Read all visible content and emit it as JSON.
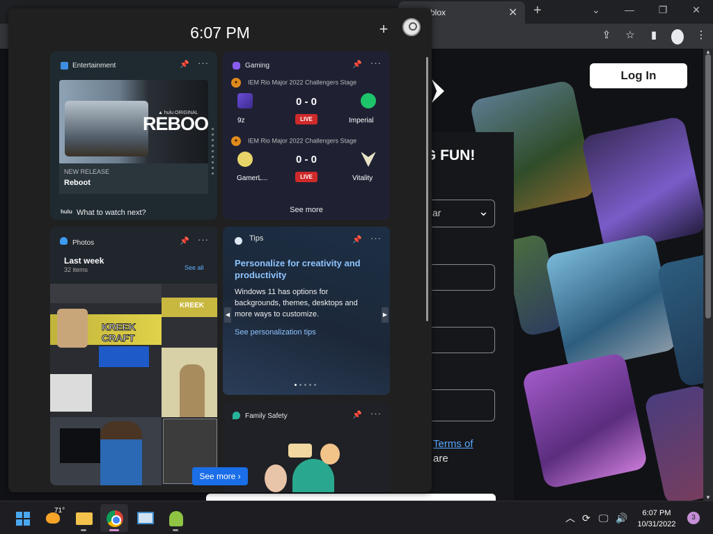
{
  "browser": {
    "tab_title": "blox",
    "tab_close": "✕",
    "new_tab": "+",
    "controls": {
      "minimize": "—",
      "maximize": "❐",
      "close": "✕"
    },
    "toolbar_icons": {
      "share": "⇪",
      "star": "☆",
      "sidebar": "▮",
      "menu": "⋮"
    }
  },
  "roblox_page": {
    "login_label": "Log In",
    "fun_text": "G FUN!",
    "year_select_value": "ar",
    "terms_link": "Terms of",
    "are_text": "are"
  },
  "widgets": {
    "time": "6:07 PM",
    "add_label": "+",
    "entertainment": {
      "title": "Entertainment",
      "show_label": "REBOOT",
      "hulu_badge": "▲ hulu ORIGINAL",
      "kicker": "NEW RELEASE",
      "show_title": "Reboot",
      "source": "hulu",
      "footer": "What to watch next?"
    },
    "gaming": {
      "title": "Gaming",
      "matches": [
        {
          "event": "IEM Rio Major 2022 Challengers Stage",
          "team_a": "9z",
          "team_b": "Imperial",
          "score": "0 - 0",
          "status": "LIVE"
        },
        {
          "event": "IEM Rio Major 2022 Challengers Stage",
          "team_a": "GamerL...",
          "team_b": "Vitality",
          "score": "0 - 0",
          "status": "LIVE"
        }
      ],
      "see_more": "See more"
    },
    "photos": {
      "title": "Photos",
      "period": "Last week",
      "count": "32 items",
      "see_all": "See all",
      "kreek_label": "KREEK CRAFT",
      "kreek_label_small": "KREEK"
    },
    "tips": {
      "title": "Tips",
      "headline": "Personalize for creativity and productivity",
      "body": "Windows 11 has options for backgrounds, themes, desktops and more ways to customize.",
      "link": "See personalization tips"
    },
    "family": {
      "title": "Family Safety"
    },
    "see_more_button": "See more ›"
  },
  "taskbar": {
    "weather_temp": "71°",
    "time": "6:07 PM",
    "date": "10/31/2022",
    "notifications": "3",
    "tray_icons": {
      "chevron": "︿",
      "sync": "⟳",
      "network": "🖵",
      "volume": "🔊"
    }
  }
}
